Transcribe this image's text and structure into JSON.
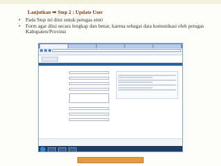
{
  "slide": {
    "heading_prefix": "Lanjutkan",
    "heading_arrow": "➥",
    "heading_text": "Step 2 : Update User",
    "bullets": [
      "Pada Step ini diisi untuk petugas entri",
      "Form agar diisi secara lengkap dan benar, karena sebagai data komunikasi  oleh petugas Kabupaten/Provinsi"
    ]
  },
  "colors": {
    "heading": "#7b3a0f",
    "bullet_text": "#303030",
    "bottom_bar": "#e59a45",
    "browser_menu": "#2d5f9e"
  },
  "screenshot": {
    "icons": [
      "back-icon",
      "forward-icon",
      "refresh-icon",
      "windows-start-icon"
    ]
  }
}
